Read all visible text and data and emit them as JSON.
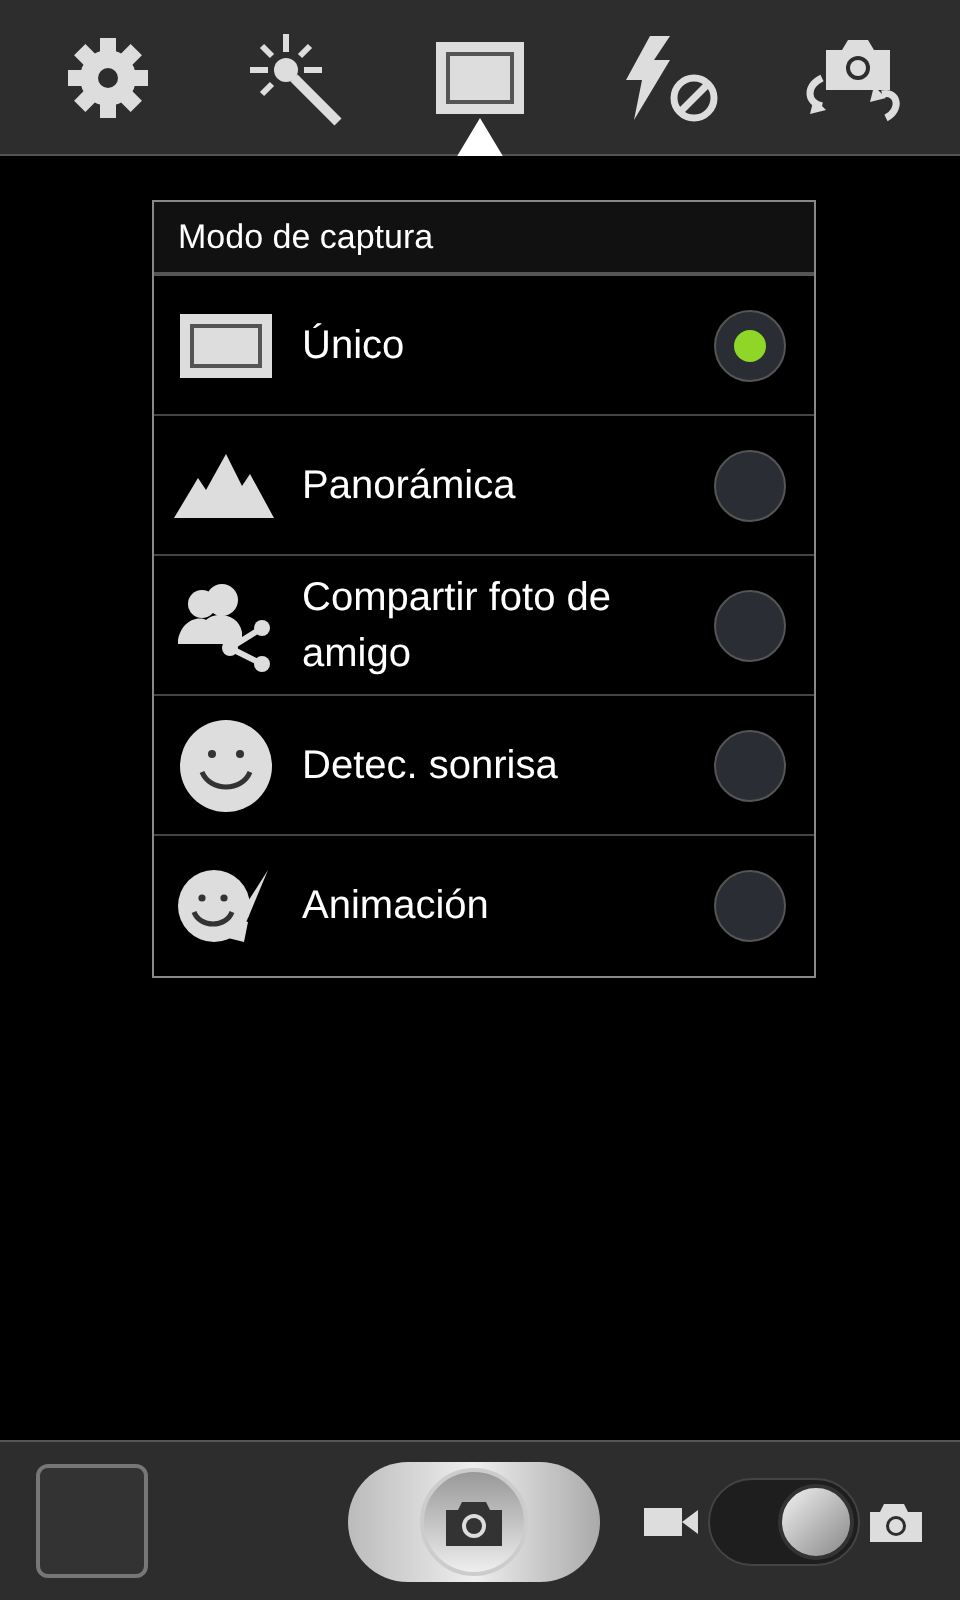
{
  "toolbar": [
    {
      "kind": "settings",
      "selected": false
    },
    {
      "kind": "effects",
      "selected": false
    },
    {
      "kind": "mode",
      "selected": true
    },
    {
      "kind": "flash",
      "selected": false
    },
    {
      "kind": "switch-camera",
      "selected": false
    }
  ],
  "menu": {
    "title": "Modo de captura",
    "options": [
      {
        "kind": "single",
        "label": "Único",
        "selected": true
      },
      {
        "kind": "panorama",
        "label": "Panorámica",
        "selected": false
      },
      {
        "kind": "share",
        "label": "Compartir foto de amigo",
        "selected": false
      },
      {
        "kind": "smile",
        "label": "Detec. sonrisa",
        "selected": false
      },
      {
        "kind": "animation",
        "label": "Animación",
        "selected": false
      }
    ]
  },
  "mode_switch": {
    "photo": true
  }
}
